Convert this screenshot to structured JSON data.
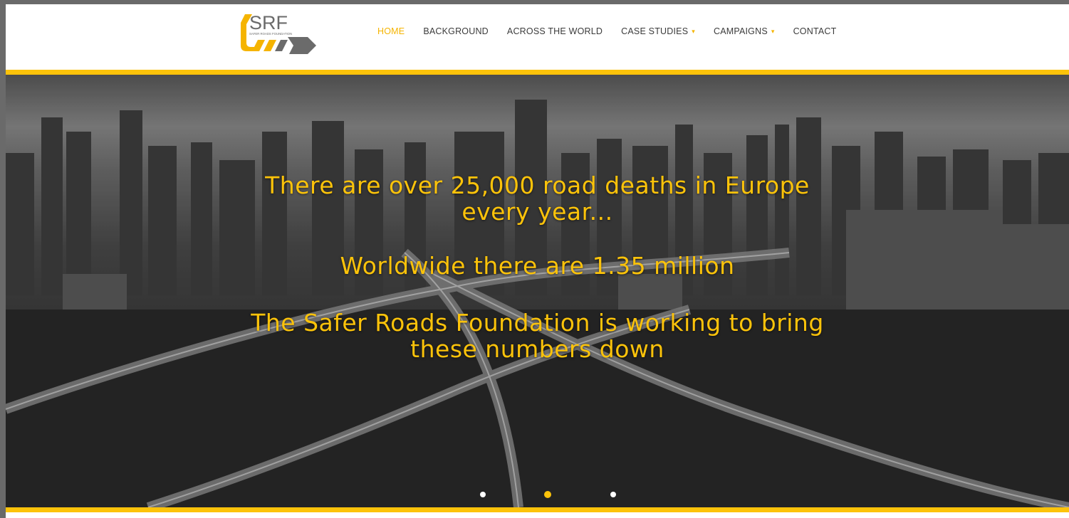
{
  "logo": {
    "text": "SRF",
    "tagline": "SAFER ROADS FOUNDATION",
    "colors": {
      "yellow": "#f5b400",
      "gray": "#6b6b6b"
    }
  },
  "nav": {
    "items": [
      {
        "label": "HOME",
        "active": true,
        "has_dropdown": false
      },
      {
        "label": "BACKGROUND",
        "active": false,
        "has_dropdown": false
      },
      {
        "label": "ACROSS THE WORLD",
        "active": false,
        "has_dropdown": false
      },
      {
        "label": "CASE STUDIES",
        "active": false,
        "has_dropdown": true
      },
      {
        "label": "CAMPAIGNS",
        "active": false,
        "has_dropdown": true
      },
      {
        "label": "CONTACT",
        "active": false,
        "has_dropdown": false
      }
    ],
    "caret_icon": "chevron-down-icon",
    "caret_glyph": "▾",
    "active_color": "#f5b400"
  },
  "hero": {
    "lines": [
      [
        "There are over 25,000 road deaths in Europe",
        "every year..."
      ],
      [
        "Worldwide there are 1.35 million"
      ],
      [
        "The Safer Roads Foundation is working to bring",
        "these numbers down"
      ]
    ],
    "text_color": "#fcc30a",
    "background": "black-and-white city skyline with highway interchange"
  },
  "carousel": {
    "slide_count": 3,
    "active_index": 1
  },
  "accent_bar_color": "#fcc30a"
}
